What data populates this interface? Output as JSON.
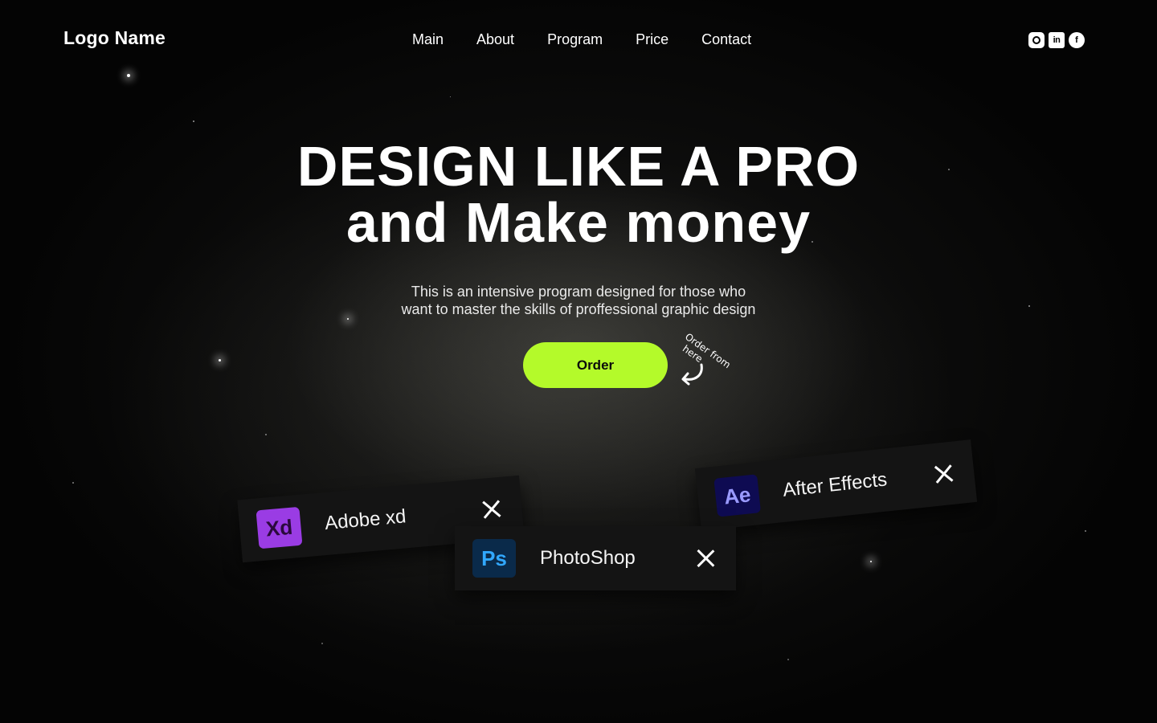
{
  "header": {
    "logo": "Logo Name",
    "nav": [
      {
        "label": "Main"
      },
      {
        "label": "About"
      },
      {
        "label": "Program"
      },
      {
        "label": "Price"
      },
      {
        "label": "Contact"
      }
    ],
    "socials": [
      {
        "icon": "instagram-icon"
      },
      {
        "icon": "linkedin-icon",
        "glyph": "in"
      },
      {
        "icon": "facebook-icon",
        "glyph": "f"
      }
    ]
  },
  "hero": {
    "title_line1": "DESIGN LIKE A PRO",
    "title_line2": "and Make money",
    "subtitle_line1": "This is an intensive program designed for those who",
    "subtitle_line2": "want to master the skills of proffessional graphic design",
    "order_label": "Order",
    "hint_line1": "Order from",
    "hint_line2": "here"
  },
  "apps": [
    {
      "name": "Adobe xd",
      "icon_text": "Xd",
      "icon_bg": "#9a3ce4",
      "icon_fg": "#2b0a3d"
    },
    {
      "name": "After Effects",
      "icon_text": "Ae",
      "icon_bg": "#0e0b52",
      "icon_fg": "#9a9aff"
    },
    {
      "name": "PhotoShop",
      "icon_text": "Ps",
      "icon_bg": "#0a2a4a",
      "icon_fg": "#31a8ff"
    }
  ],
  "colors": {
    "accent": "#b4fa2a",
    "background": "#050505",
    "card": "#141414"
  }
}
